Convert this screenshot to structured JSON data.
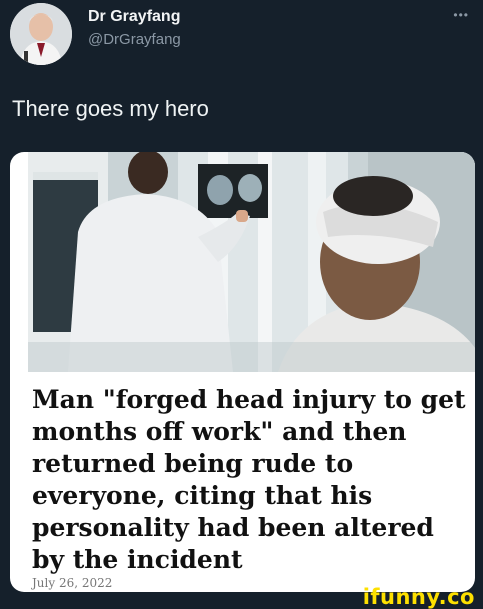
{
  "author": {
    "display_name": "Dr Grayfang",
    "handle": "@DrGrayfang",
    "more_icon": "more-dots-icon"
  },
  "tweet": {
    "text": "There goes my hero"
  },
  "card": {
    "headline": "Man \"forged head injury to get months off work\" and then returned being rude to everyone, citing that his personality had been altered by the incident",
    "date": "July 26, 2022"
  },
  "watermark": {
    "text": "ifunny.co"
  }
}
